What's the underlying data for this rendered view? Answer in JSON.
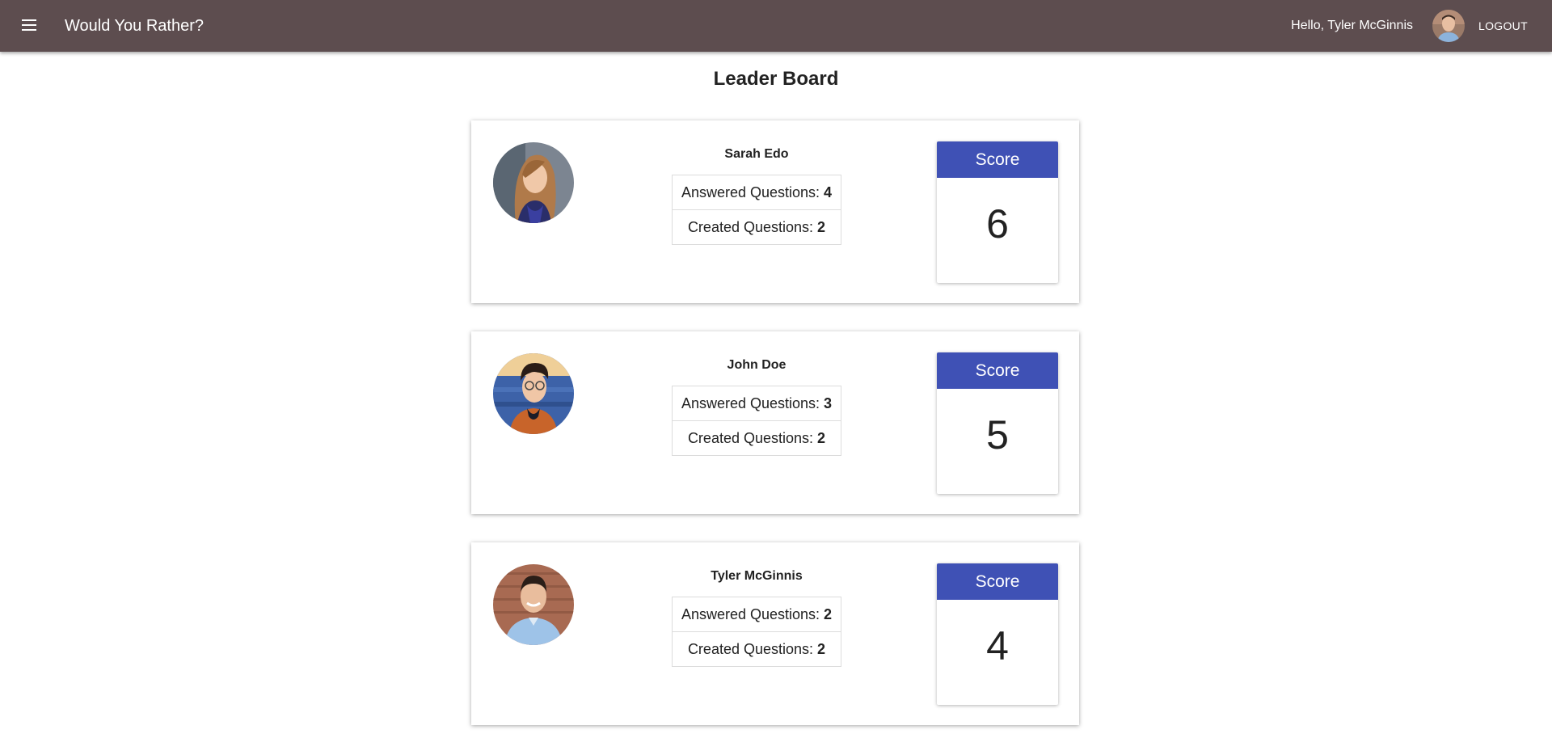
{
  "header": {
    "app_title": "Would You Rather?",
    "greeting": "Hello, Tyler McGinnis",
    "logout_label": "LOGOUT",
    "menu_icon": "hamburger-menu-icon",
    "color": "#5d4d4f"
  },
  "main": {
    "title": "Leader Board"
  },
  "leaderboard": [
    {
      "name": "Sarah Edo",
      "answered_label": "Answered Questions: ",
      "answered": "4",
      "created_label": "Created Questions: ",
      "created": "2",
      "score_label": "Score",
      "score": "6"
    },
    {
      "name": "John Doe",
      "answered_label": "Answered Questions: ",
      "answered": "3",
      "created_label": "Created Questions: ",
      "created": "2",
      "score_label": "Score",
      "score": "5"
    },
    {
      "name": "Tyler McGinnis",
      "answered_label": "Answered Questions: ",
      "answered": "2",
      "created_label": "Created Questions: ",
      "created": "2",
      "score_label": "Score",
      "score": "4"
    }
  ],
  "colors": {
    "score_header": "#3f51b5",
    "app_bar": "#5d4d4f"
  }
}
